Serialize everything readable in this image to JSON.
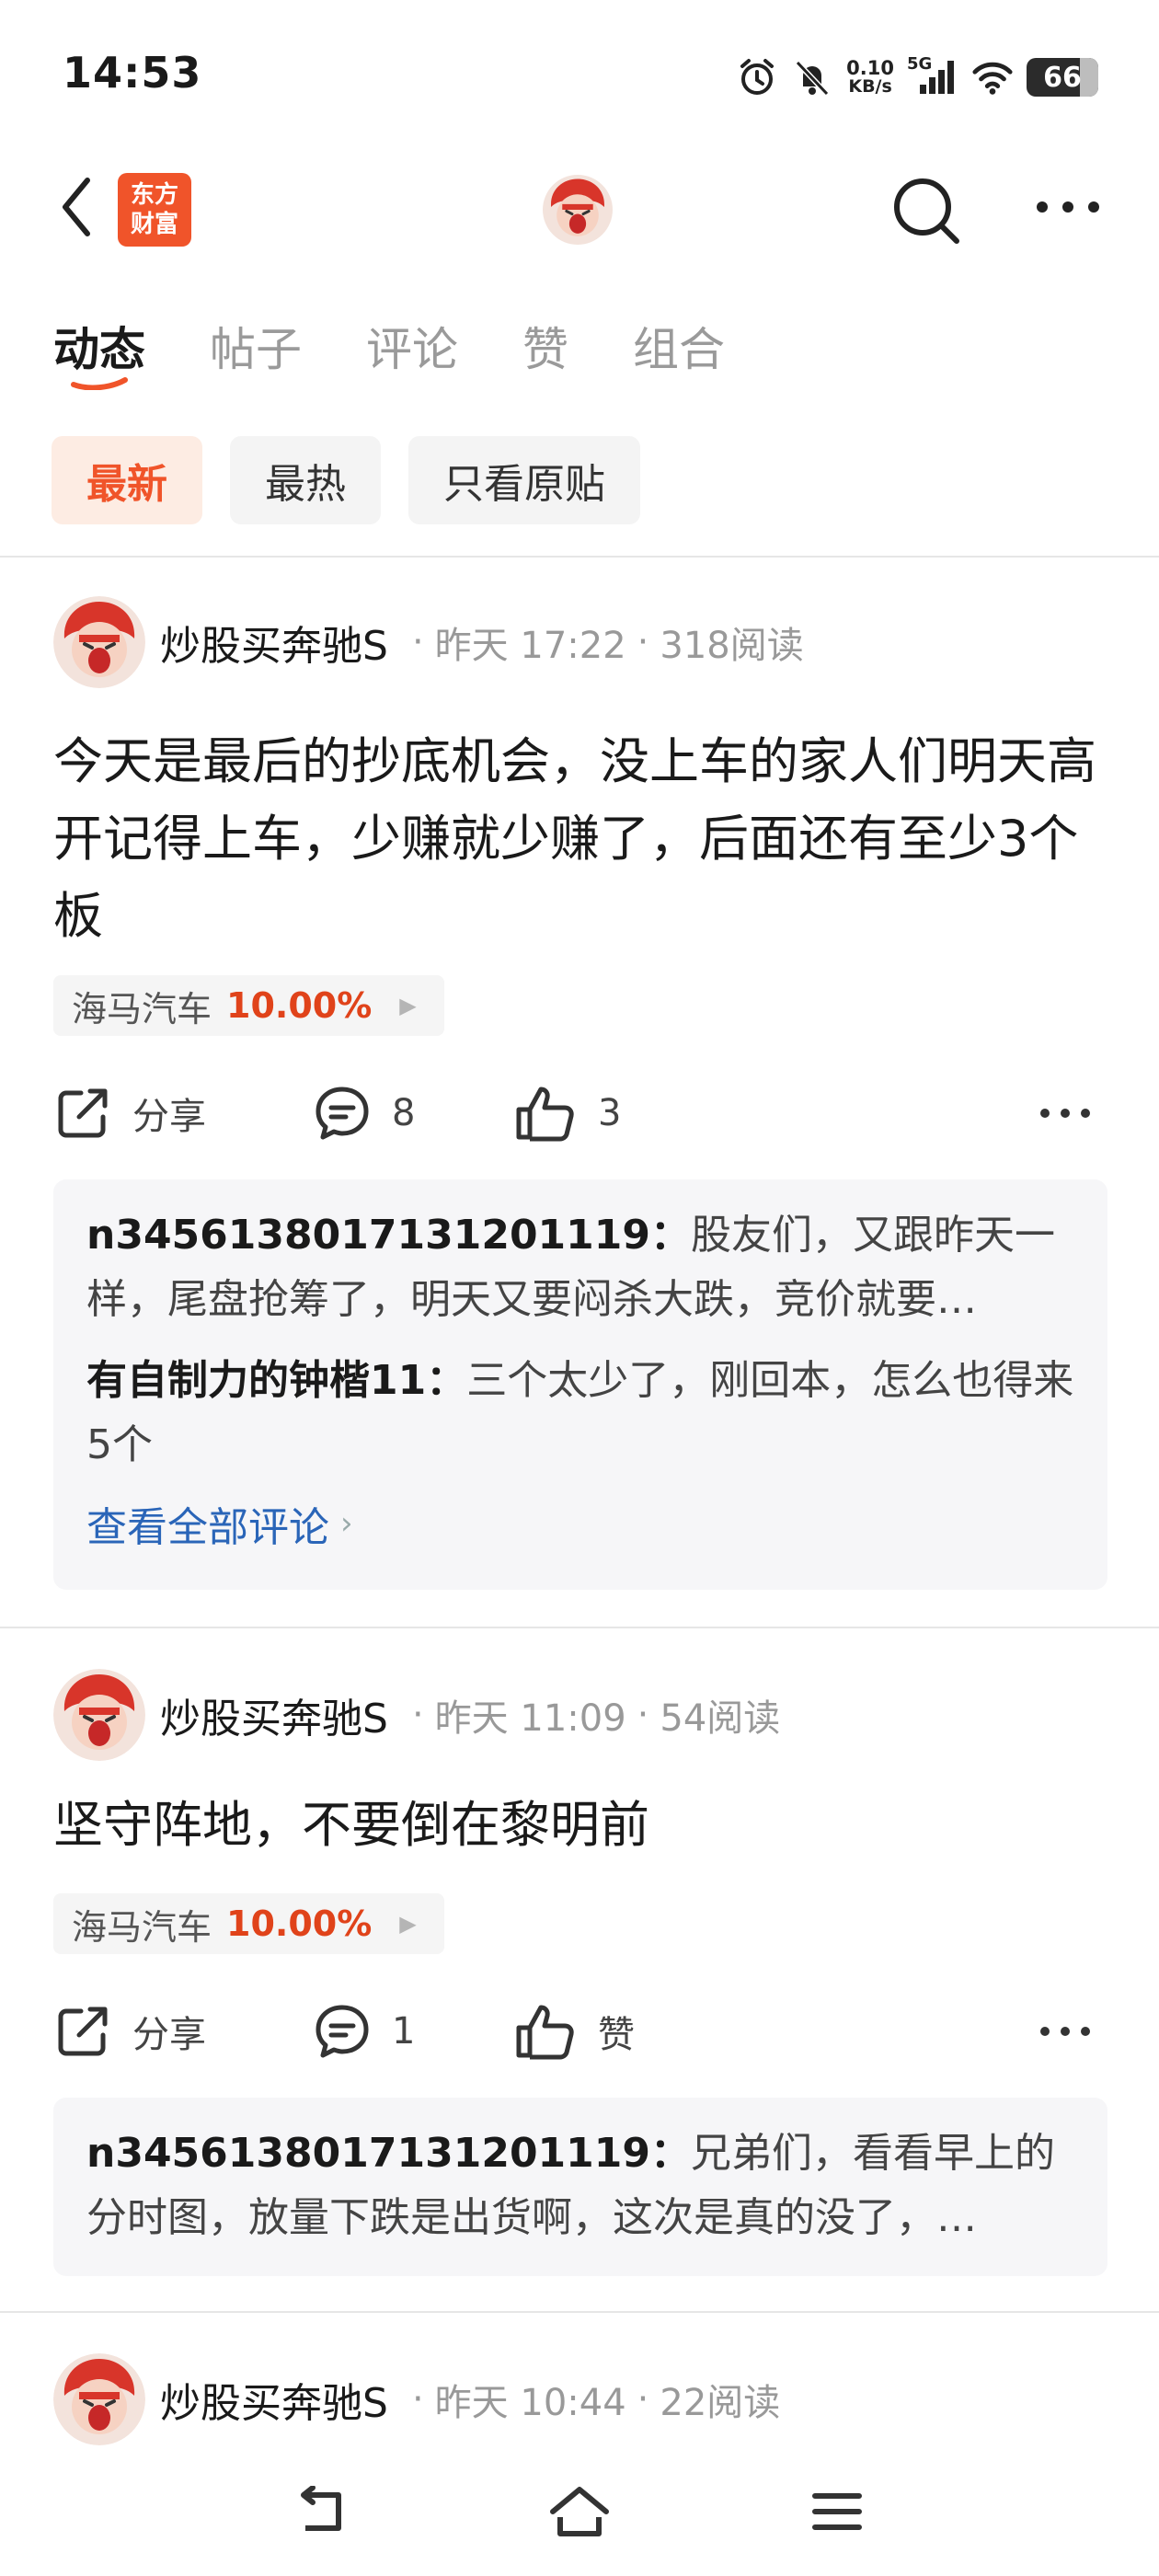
{
  "status_bar": {
    "time": "14:53",
    "net_speed_value": "0.10",
    "net_speed_unit": "KB/s",
    "network_type": "5G",
    "battery": "66",
    "icons": [
      "alarm-icon",
      "mute-bell-icon",
      "signal-icon",
      "wifi-icon",
      "battery-icon"
    ]
  },
  "header": {
    "logo_line1": "东方",
    "logo_line2": "财富",
    "icons": [
      "back-icon",
      "search-icon",
      "more-icon"
    ]
  },
  "tabs": [
    {
      "label": "动态",
      "active": true
    },
    {
      "label": "帖子",
      "active": false
    },
    {
      "label": "评论",
      "active": false
    },
    {
      "label": "赞",
      "active": false
    },
    {
      "label": "组合",
      "active": false
    }
  ],
  "filters": [
    {
      "label": "最新",
      "active": true
    },
    {
      "label": "最热",
      "active": false
    },
    {
      "label": "只看原贴",
      "active": false
    }
  ],
  "posts": [
    {
      "author": "炒股买奔驰S",
      "time": "昨天 17:22",
      "reads": "318阅读",
      "text": "今天是最后的抄底机会，没上车的家人们明天高开记得上车，少赚就少赚了，后面还有至少3个板",
      "stock_name": "海马汽车",
      "stock_change": "10.00%",
      "share_label": "分享",
      "comment_count": "8",
      "like_count": "3",
      "comments": [
        {
          "user": "n3456138017131201119：",
          "text": "股友们，又跟昨天一样，尾盘抢筹了，明天又要闷杀大跌，竞价就要…"
        },
        {
          "user": "有自制力的钟楷11：",
          "text": "三个太少了，刚回本，怎么也得来5个"
        }
      ],
      "view_all": "查看全部评论"
    },
    {
      "author": "炒股买奔驰S",
      "time": "昨天 11:09",
      "reads": "54阅读",
      "text": "坚守阵地，不要倒在黎明前",
      "stock_name": "海马汽车",
      "stock_change": "10.00%",
      "share_label": "分享",
      "comment_count": "1",
      "like_count": "赞",
      "comments": [
        {
          "user": "n3456138017131201119：",
          "text": "兄弟们，看看早上的分时图，放量下跌是出货啊，这次是真的没了，…"
        }
      ]
    },
    {
      "author": "炒股买奔驰S",
      "time": "昨天 10:44",
      "reads": "22阅读"
    }
  ],
  "bottom_nav": [
    "back-nav-icon",
    "home-nav-icon",
    "menu-nav-icon"
  ],
  "colors": {
    "accent": "#f0542a",
    "stock_up": "#e0431a",
    "link": "#2a65b8",
    "muted": "#999999"
  }
}
